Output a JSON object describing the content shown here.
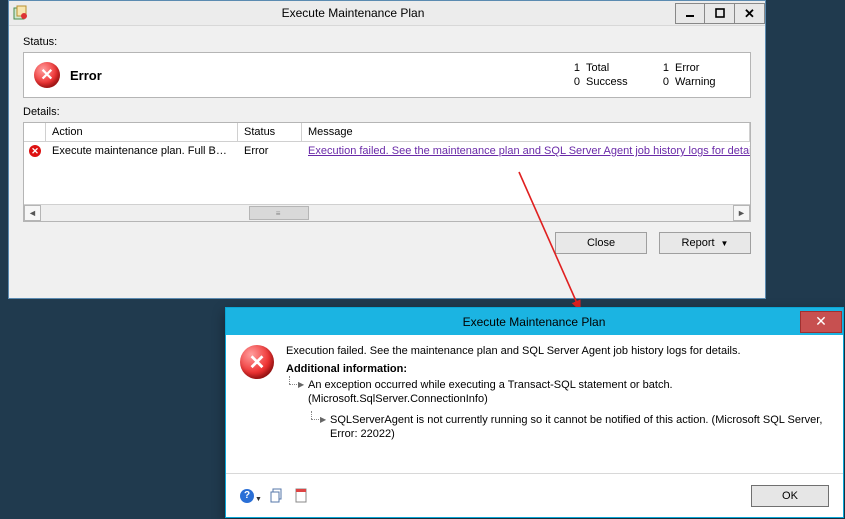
{
  "window1": {
    "title": "Execute Maintenance Plan",
    "status_label": "Status:",
    "status_text": "Error",
    "counts": {
      "total_n": "1",
      "total_l": "Total",
      "success_n": "0",
      "success_l": "Success",
      "error_n": "1",
      "error_l": "Error",
      "warning_n": "0",
      "warning_l": "Warning"
    },
    "details_label": "Details:",
    "columns": {
      "action": "Action",
      "status": "Status",
      "message": "Message"
    },
    "row": {
      "action": "Execute maintenance plan. Full Bac...",
      "status": "Error",
      "message": "Execution failed. See the maintenance plan and SQL Server Agent job history logs for details.("
    },
    "buttons": {
      "close": "Close",
      "report": "Report"
    }
  },
  "window2": {
    "title": "Execute Maintenance Plan",
    "message": "Execution failed. See the maintenance plan and SQL Server Agent job history logs for details.",
    "additional_heading": "Additional information:",
    "item1": "An exception occurred while executing a Transact-SQL statement or batch. (Microsoft.SqlServer.ConnectionInfo)",
    "item2": "SQLServerAgent is not currently running so it cannot be notified of this action. (Microsoft SQL Server, Error: 22022)",
    "ok": "OK"
  }
}
